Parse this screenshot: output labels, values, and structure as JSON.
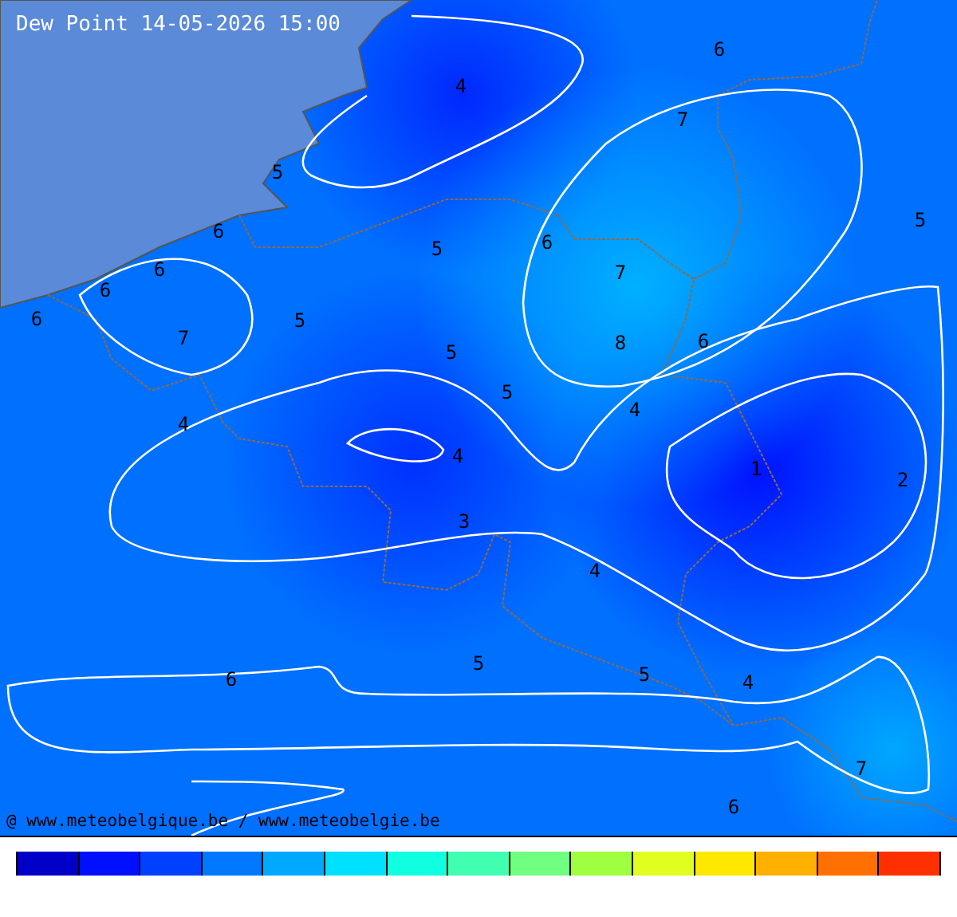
{
  "title": "Dew Point 14-05-2026 15:00",
  "credit": "@ www.meteobelgique.be / www.meteobelgie.be",
  "contour_labels": [
    "6",
    "4",
    "7",
    "5",
    "6",
    "5",
    "6",
    "5",
    "6",
    "7",
    "6",
    "6",
    "5",
    "7",
    "8",
    "6",
    "5",
    "5",
    "4",
    "4",
    "4",
    "1",
    "2",
    "3",
    "4",
    "6",
    "5",
    "5",
    "4",
    "7",
    "6"
  ],
  "legend": [
    {
      "color": "#0000c8"
    },
    {
      "color": "#0010ff"
    },
    {
      "color": "#0040ff"
    },
    {
      "color": "#0078ff"
    },
    {
      "color": "#00a8ff"
    },
    {
      "color": "#00e0ff"
    },
    {
      "color": "#10ffe0"
    },
    {
      "color": "#40ffb0"
    },
    {
      "color": "#70ff80"
    },
    {
      "color": "#a0ff40"
    },
    {
      "color": "#e0ff20"
    },
    {
      "color": "#ffe800"
    },
    {
      "color": "#ffb000"
    },
    {
      "color": "#ff7000"
    },
    {
      "color": "#ff3000"
    }
  ]
}
